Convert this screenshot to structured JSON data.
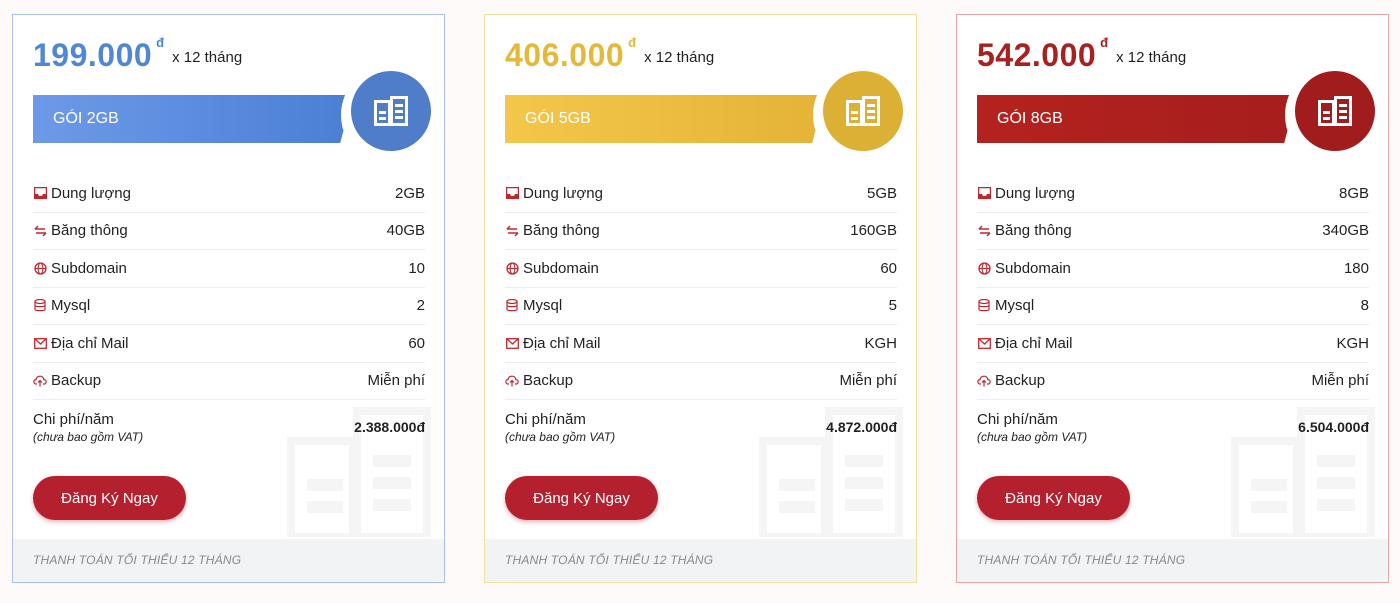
{
  "colors": {
    "blue": "#4f86d6",
    "gold": "#e6b83a",
    "red": "#a8201f",
    "cta": "#b5202e",
    "feature_icon": "#c0272d"
  },
  "plans": [
    {
      "price": "199.000",
      "currency": "đ",
      "period": "x 12 tháng",
      "name": "GÓI 2GB",
      "features": [
        {
          "icon": "inbox-icon",
          "label": "Dung lượng",
          "value": "2GB"
        },
        {
          "icon": "arrows-icon",
          "label": "Băng thông",
          "value": "40GB"
        },
        {
          "icon": "globe-icon",
          "label": "Subdomain",
          "value": "10"
        },
        {
          "icon": "database-icon",
          "label": "Mysql",
          "value": "2"
        },
        {
          "icon": "envelope-icon",
          "label": "Địa chỉ Mail",
          "value": "60"
        },
        {
          "icon": "cloud-icon",
          "label": "Backup",
          "value": "Miễn phí"
        }
      ],
      "total_label": "Chi phí/năm",
      "total_note": "(chưa bao gồm VAT)",
      "total_value": "2.388.000đ",
      "cta": "Đăng Ký Ngay",
      "footer": "THANH TOÁN TỐI THIỂU 12 THÁNG"
    },
    {
      "price": "406.000",
      "currency": "đ",
      "period": "x 12 tháng",
      "name": "GÓI 5GB",
      "features": [
        {
          "icon": "inbox-icon",
          "label": "Dung lượng",
          "value": "5GB"
        },
        {
          "icon": "arrows-icon",
          "label": "Băng thông",
          "value": "160GB"
        },
        {
          "icon": "globe-icon",
          "label": "Subdomain",
          "value": "60"
        },
        {
          "icon": "database-icon",
          "label": "Mysql",
          "value": "5"
        },
        {
          "icon": "envelope-icon",
          "label": "Địa chỉ Mail",
          "value": "KGH"
        },
        {
          "icon": "cloud-icon",
          "label": "Backup",
          "value": "Miễn phí"
        }
      ],
      "total_label": "Chi phí/năm",
      "total_note": "(chưa bao gồm VAT)",
      "total_value": "4.872.000đ",
      "cta": "Đăng Ký Ngay",
      "footer": "THANH TOÁN TỐI THIỂU 12 THÁNG"
    },
    {
      "price": "542.000",
      "currency": "đ",
      "period": "x 12 tháng",
      "name": "GÓI 8GB",
      "features": [
        {
          "icon": "inbox-icon",
          "label": "Dung lượng",
          "value": "8GB"
        },
        {
          "icon": "arrows-icon",
          "label": "Băng thông",
          "value": "340GB"
        },
        {
          "icon": "globe-icon",
          "label": "Subdomain",
          "value": "180"
        },
        {
          "icon": "database-icon",
          "label": "Mysql",
          "value": "8"
        },
        {
          "icon": "envelope-icon",
          "label": "Địa chỉ Mail",
          "value": "KGH"
        },
        {
          "icon": "cloud-icon",
          "label": "Backup",
          "value": "Miễn phí"
        }
      ],
      "total_label": "Chi phí/năm",
      "total_note": "(chưa bao gồm VAT)",
      "total_value": "6.504.000đ",
      "cta": "Đăng Ký Ngay",
      "footer": "THANH TOÁN TỐI THIỂU 12 THÁNG"
    }
  ]
}
